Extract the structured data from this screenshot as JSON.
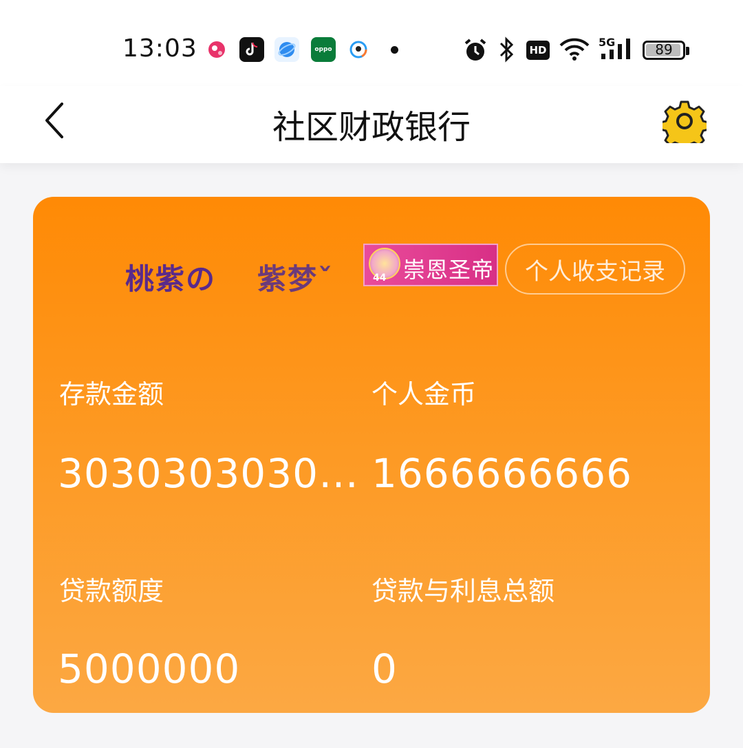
{
  "status_bar": {
    "time": "13:03",
    "notification_icons": [
      "kugou-icon",
      "tiktok-icon",
      "browser-icon",
      "oppo-icon",
      "qq-icon"
    ],
    "hd_label": "HD",
    "network_label": "5G",
    "battery": "89"
  },
  "nav": {
    "title": "社区财政银行"
  },
  "card": {
    "user_name_part1": "桃紫の",
    "user_name_part2": "紫梦ˇ",
    "badge_text": "崇恩圣帝",
    "badge_level": "44",
    "record_button": "个人收支记录",
    "deposit_label": "存款金额",
    "deposit_value": "30303030303…",
    "coins_label": "个人金币",
    "coins_value": "1666666666",
    "loan_limit_label": "贷款额度",
    "loan_limit_value": "5000000",
    "loan_total_label": "贷款与利息总额",
    "loan_total_value": "0"
  },
  "colors": {
    "card_top": "#ff8a05",
    "card_bottom": "#fca843",
    "name_purple": "#5a2a8a"
  }
}
